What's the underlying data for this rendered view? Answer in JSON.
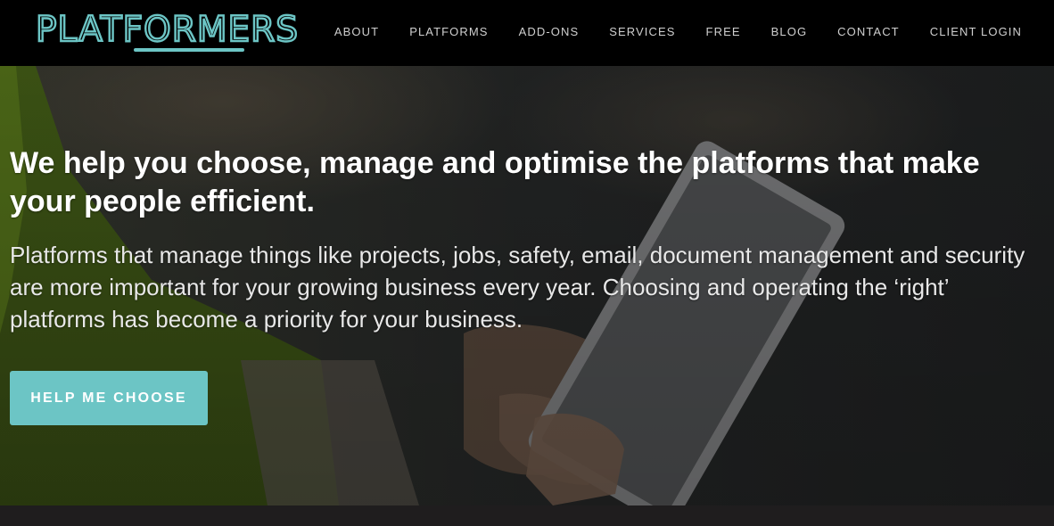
{
  "brand": {
    "logo_text": "PLATFORMERS",
    "accent_color": "#6cc5c5"
  },
  "nav": {
    "items": [
      "ABOUT",
      "PLATFORMS",
      "ADD-ONS",
      "SERVICES",
      "FREE",
      "BLOG",
      "CONTACT",
      "CLIENT LOGIN"
    ]
  },
  "hero": {
    "headline": "We help you choose, manage and optimise the platforms that make your people efficient.",
    "subtext": "Platforms that manage things like projects, jobs, safety, email, document management and security are more important for your growing business every year. Choosing and operating the ‘right’ platforms has become a priority for your business.",
    "cta_label": "HELP ME CHOOSE",
    "background_image": "worker in hi-vis vest holding a tablet",
    "cta_color": "#6cc5c5"
  }
}
